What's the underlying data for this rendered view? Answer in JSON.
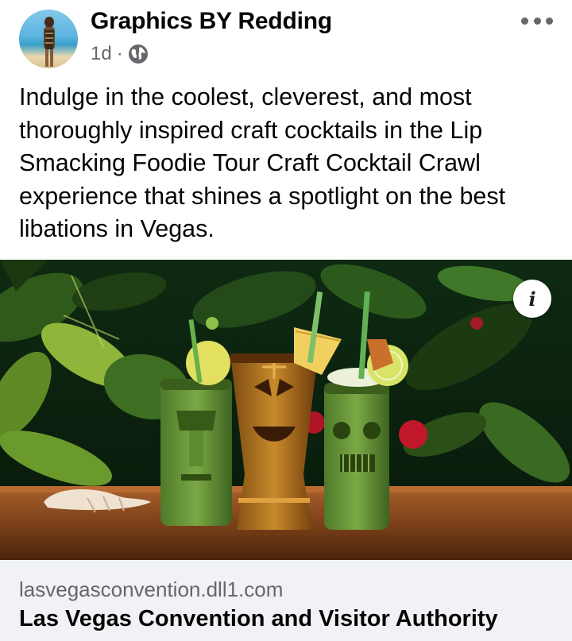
{
  "post": {
    "author": "Graphics BY Redding",
    "time": "1d",
    "separator": "·",
    "privacy_icon": "globe-icon",
    "menu_icon": "more-horizontal-icon",
    "text": "Indulge in the coolest, cleverest, and most thoroughly inspired craft cocktails in the Lip Smacking Foodie Tour Craft Cocktail Crawl experience that shines a spotlight on the best libations in Vegas."
  },
  "link_preview": {
    "image_alt": "Three tiki mug cocktails garnished with pineapple and lime in front of tropical leaves",
    "info_icon": "info-icon",
    "info_label": "i",
    "domain": "lasvegasconvention.dll1.com",
    "title": "Las Vegas Convention and Visitor Authority"
  },
  "colors": {
    "text_primary": "#050505",
    "text_secondary": "#65676b",
    "footer_bg": "#f0f2f5"
  }
}
